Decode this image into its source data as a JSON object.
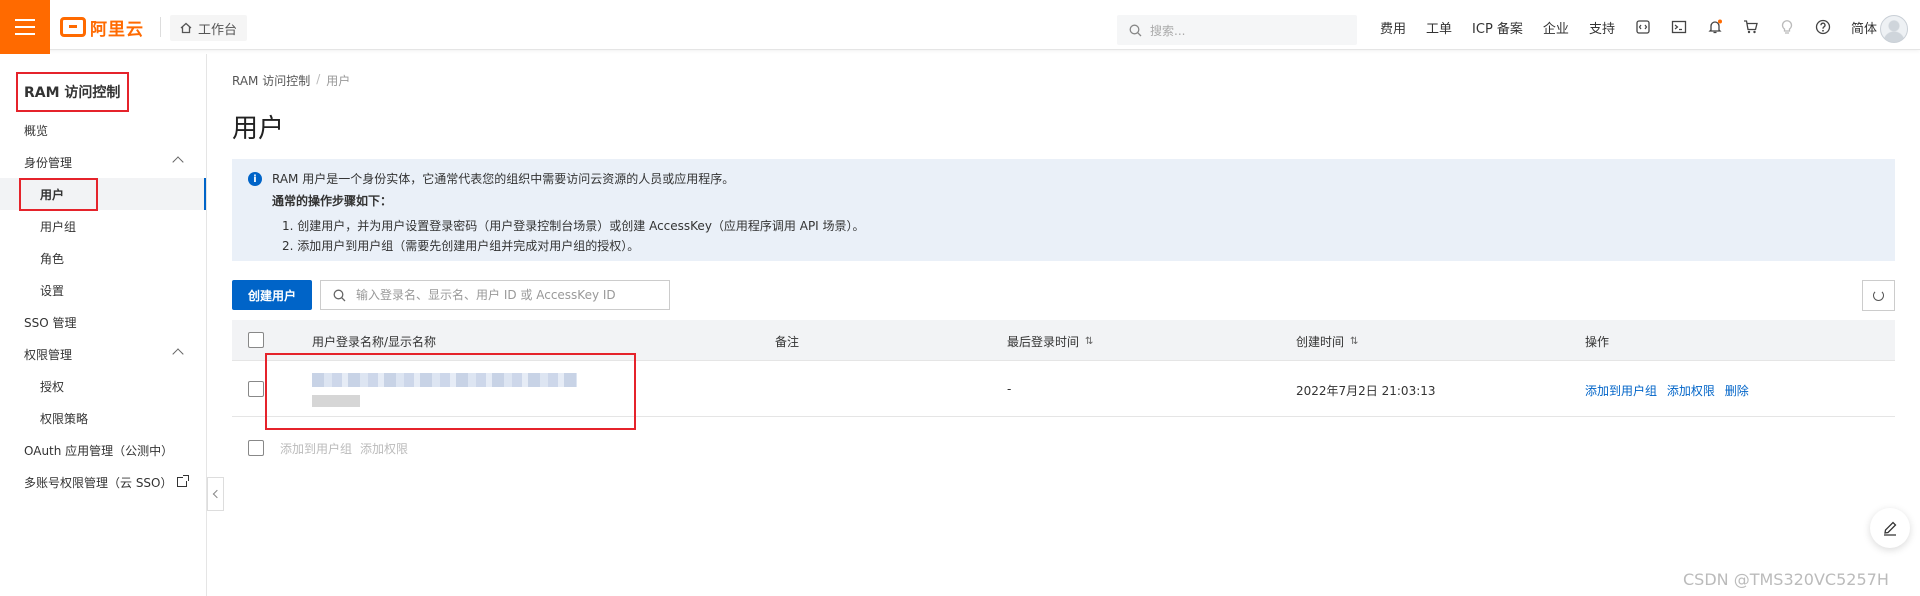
{
  "topbar": {
    "logo_text": "阿里云",
    "workbench_label": "工作台",
    "search_placeholder": "搜索...",
    "nav_links": [
      "费用",
      "工单",
      "ICP 备案",
      "企业",
      "支持"
    ],
    "language_label": "简体"
  },
  "sidebar": {
    "title": "RAM 访问控制",
    "items": [
      {
        "label": "概览"
      },
      {
        "label": "身份管理"
      },
      {
        "label": "用户"
      },
      {
        "label": "用户组"
      },
      {
        "label": "角色"
      },
      {
        "label": "设置"
      },
      {
        "label": "SSO 管理"
      },
      {
        "label": "权限管理"
      },
      {
        "label": "授权"
      },
      {
        "label": "权限策略"
      },
      {
        "label": "OAuth 应用管理（公测中）"
      },
      {
        "label": "多账号权限管理（云 SSO）"
      }
    ]
  },
  "breadcrumb": {
    "root": "RAM 访问控制",
    "sep": "/",
    "current": "用户"
  },
  "page_title": "用户",
  "notice": {
    "line1": "RAM 用户是一个身份实体，它通常代表您的组织中需要访问云资源的人员或应用程序。",
    "line2": "通常的操作步骤如下：",
    "line3": "1. 创建用户，并为用户设置登录密码（用户登录控制台场景）或创建 AccessKey（应用程序调用 API 场景）。",
    "line4": "2. 添加用户到用户组（需要先创建用户组并完成对用户组的授权）。"
  },
  "toolbar": {
    "create_label": "创建用户",
    "search_placeholder": "输入登录名、显示名、用户 ID 或 AccessKey ID"
  },
  "table": {
    "headers": {
      "name": "用户登录名称/显示名称",
      "note": "备注",
      "last_login": "最后登录时间",
      "created": "创建时间",
      "actions": "操作"
    },
    "rows": [
      {
        "last_login": "-",
        "created": "2022年7月2日 21:03:13",
        "actions": [
          "添加到用户组",
          "添加权限",
          "删除"
        ]
      }
    ]
  },
  "bulk_actions": [
    "添加到用户组",
    "添加权限"
  ],
  "watermark": "CSDN @TMS320VC5257H"
}
